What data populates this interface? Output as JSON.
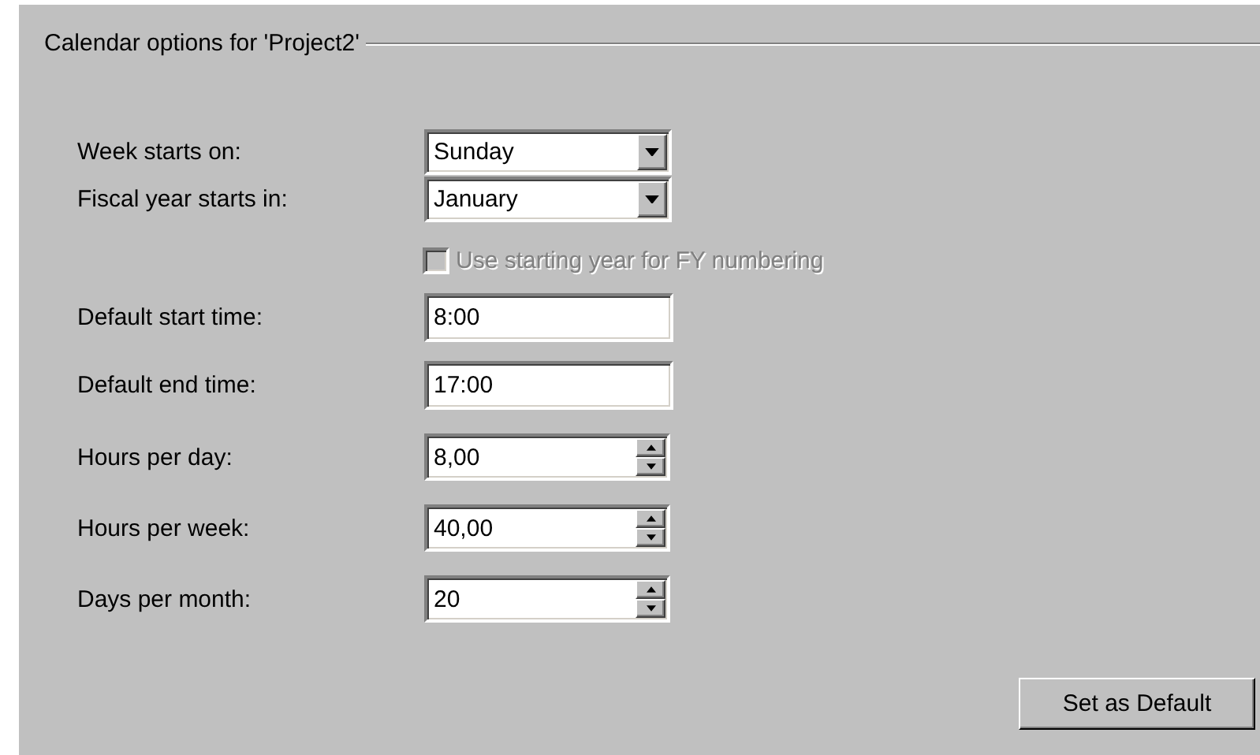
{
  "group": {
    "title": "Calendar options for 'Project2'"
  },
  "fields": [
    {
      "kind": "dropdown",
      "label": "Week starts on:",
      "value": "Sunday"
    },
    {
      "kind": "dropdown",
      "label": "Fiscal year starts in:",
      "value": "January"
    },
    {
      "kind": "checkbox",
      "label": "Use starting year for FY numbering",
      "checked": false,
      "disabled": true
    },
    {
      "kind": "text",
      "label": "Default start time:",
      "value": "8:00"
    },
    {
      "kind": "text",
      "label": "Default end time:",
      "value": "17:00"
    },
    {
      "kind": "spinner",
      "label": "Hours per day:",
      "value": "8,00"
    },
    {
      "kind": "spinner",
      "label": "Hours per week:",
      "value": "40,00"
    },
    {
      "kind": "spinner",
      "label": "Days per month:",
      "value": "20"
    }
  ],
  "buttons": [
    "Set as Default"
  ]
}
